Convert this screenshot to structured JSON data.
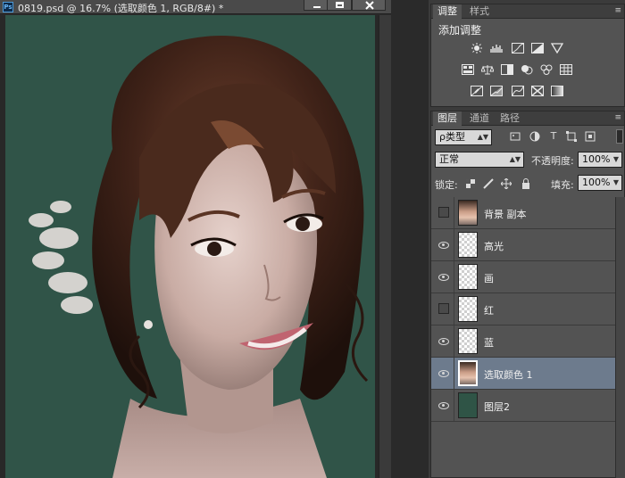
{
  "document": {
    "app_icon": "Ps",
    "title": "0819.psd @ 16.7% (选取颜色 1, RGB/8#) *"
  },
  "adjustments_panel": {
    "tabs": [
      {
        "label": "调整",
        "active": true
      },
      {
        "label": "样式",
        "active": false
      }
    ],
    "heading": "添加调整",
    "icons_row1": [
      "brightness-contrast-icon",
      "levels-icon",
      "curves-icon",
      "exposure-icon",
      "vibrance-icon"
    ],
    "icons_row2": [
      "hue-saturation-icon",
      "color-balance-icon",
      "black-white-icon",
      "photo-filter-icon",
      "channel-mixer-icon",
      "color-lookup-icon"
    ],
    "icons_row3": [
      "invert-icon",
      "posterize-icon",
      "threshold-icon",
      "selective-color-icon",
      "gradient-map-icon"
    ]
  },
  "layers_panel": {
    "tabs": [
      {
        "label": "图层",
        "active": true
      },
      {
        "label": "通道",
        "active": false
      },
      {
        "label": "路径",
        "active": false
      }
    ],
    "filter_kind": "ρ类型",
    "blend_mode": "正常",
    "opacity_label": "不透明度:",
    "opacity_value": "100%",
    "lock_label": "锁定:",
    "fill_label": "填充:",
    "fill_value": "100%",
    "layers": [
      {
        "name": "背景 副本",
        "visible": false,
        "thumb": "photo",
        "selected": false
      },
      {
        "name": "高光",
        "visible": true,
        "thumb": "transparent",
        "selected": false
      },
      {
        "name": "画",
        "visible": true,
        "thumb": "transparent",
        "selected": false
      },
      {
        "name": "红",
        "visible": false,
        "thumb": "transparent",
        "selected": false
      },
      {
        "name": "蓝",
        "visible": true,
        "thumb": "transparent",
        "selected": false
      },
      {
        "name": "选取颜色 1",
        "visible": true,
        "thumb": "photo",
        "selected": true
      },
      {
        "name": "图层2",
        "visible": true,
        "thumb": "green",
        "selected": false
      }
    ]
  },
  "colors": {
    "canvas_bg": "#305448",
    "selected_row": "#6d7b8d",
    "panel_bg": "#535353"
  }
}
